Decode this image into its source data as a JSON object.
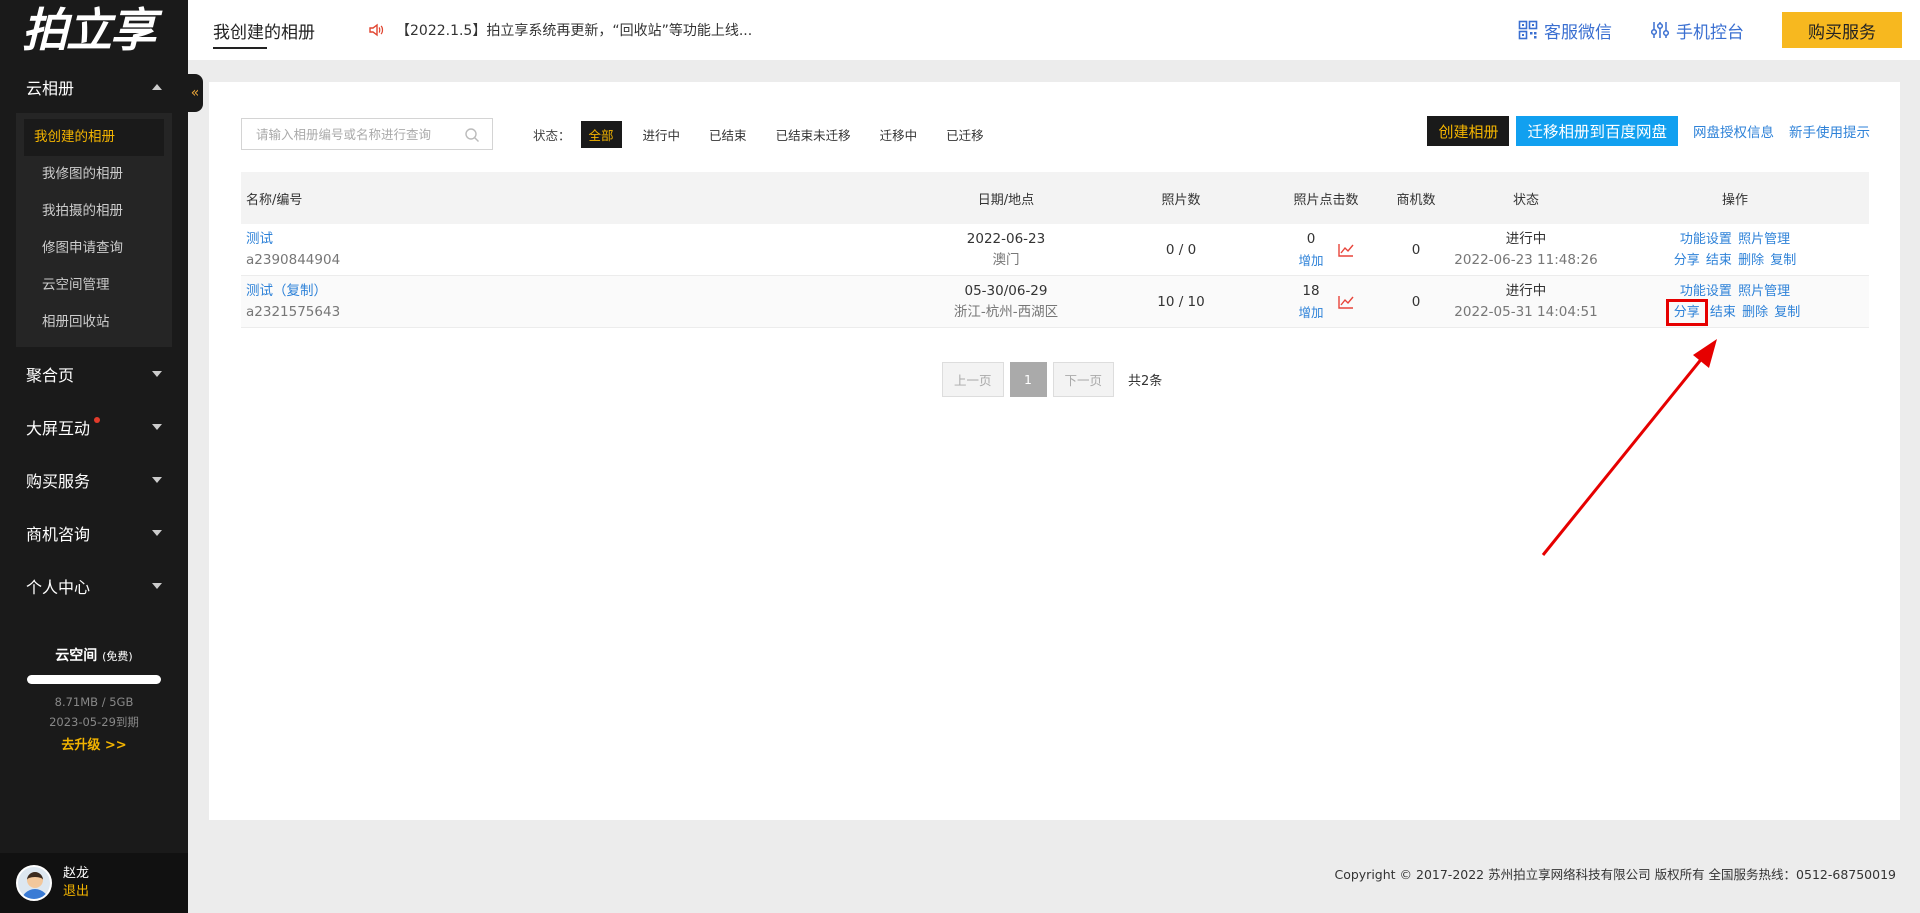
{
  "app": {
    "logo_text": "拍立享"
  },
  "sidebar": {
    "collapse_icon": "«",
    "groups": [
      {
        "label": "云相册",
        "expanded": true,
        "items": [
          {
            "label": "我创建的相册",
            "active": true
          },
          {
            "label": "我修图的相册"
          },
          {
            "label": "我拍摄的相册"
          },
          {
            "label": "修图申请查询"
          },
          {
            "label": "云空间管理"
          },
          {
            "label": "相册回收站"
          }
        ]
      },
      {
        "label": "聚合页"
      },
      {
        "label": "大屏互动",
        "badge_dot": true
      },
      {
        "label": "购买服务"
      },
      {
        "label": "商机咨询"
      },
      {
        "label": "个人中心"
      }
    ],
    "space": {
      "title": "云空间",
      "plan": "(免费)",
      "usage": "8.71MB / 5GB",
      "expire": "2023-05-29到期",
      "upgrade": "去升级 >>",
      "used_fraction": 0.0017
    },
    "user": {
      "name": "赵龙",
      "logout": "退出"
    }
  },
  "header": {
    "tab": "我创建的相册",
    "notice": "【2022.1.5】拍立享系统再更新，“回收站”等功能上线...",
    "links": {
      "wechat": "客服微信",
      "mobile": "手机控台"
    },
    "buy": "购买服务"
  },
  "toolbar": {
    "search_placeholder": "请输入相册编号或名称进行查询",
    "status_label": "状态：",
    "filters": [
      "全部",
      "进行中",
      "已结束",
      "已结束未迁移",
      "迁移中",
      "已迁移"
    ],
    "active_filter": 0,
    "create": "创建相册",
    "migrate": "迁移相册到百度网盘",
    "disk_auth": "网盘授权信息",
    "tips": "新手使用提示"
  },
  "table": {
    "headers": [
      "名称/编号",
      "日期/地点",
      "照片数",
      "照片点击数",
      "商机数",
      "状态",
      "操作"
    ],
    "rows": [
      {
        "name": "测试",
        "id": "a2390844904",
        "date": "2022-06-23",
        "place": "澳门",
        "photos": "0 / 0",
        "clicks": "0",
        "add": "增加",
        "biz": "0",
        "status": "进行中",
        "time": "2022-06-23 11:48:26",
        "ops1": [
          "功能设置",
          "照片管理"
        ],
        "ops2": [
          "分享",
          "结束",
          "删除",
          "复制"
        ]
      },
      {
        "name": "测试（复制）",
        "id": "a2321575643",
        "date": "05-30/06-29",
        "place": "浙江-杭州-西湖区",
        "photos": "10 / 10",
        "clicks": "18",
        "add": "增加",
        "biz": "0",
        "status": "进行中",
        "time": "2022-05-31 14:04:51",
        "ops1": [
          "功能设置",
          "照片管理"
        ],
        "ops2": [
          "分享",
          "结束",
          "删除",
          "复制"
        ]
      }
    ]
  },
  "pagination": {
    "prev": "上一页",
    "page": "1",
    "next": "下一页",
    "total": "共2条"
  },
  "footer": "Copyright © 2017-2022   苏州拍立享网络科技有限公司  版权所有   全国服务热线：0512-68750019",
  "colors": {
    "accent": "#f3b400",
    "blue": "#2e82d8",
    "sidebar": "#1a1a1a",
    "highlight": "#e60000"
  }
}
